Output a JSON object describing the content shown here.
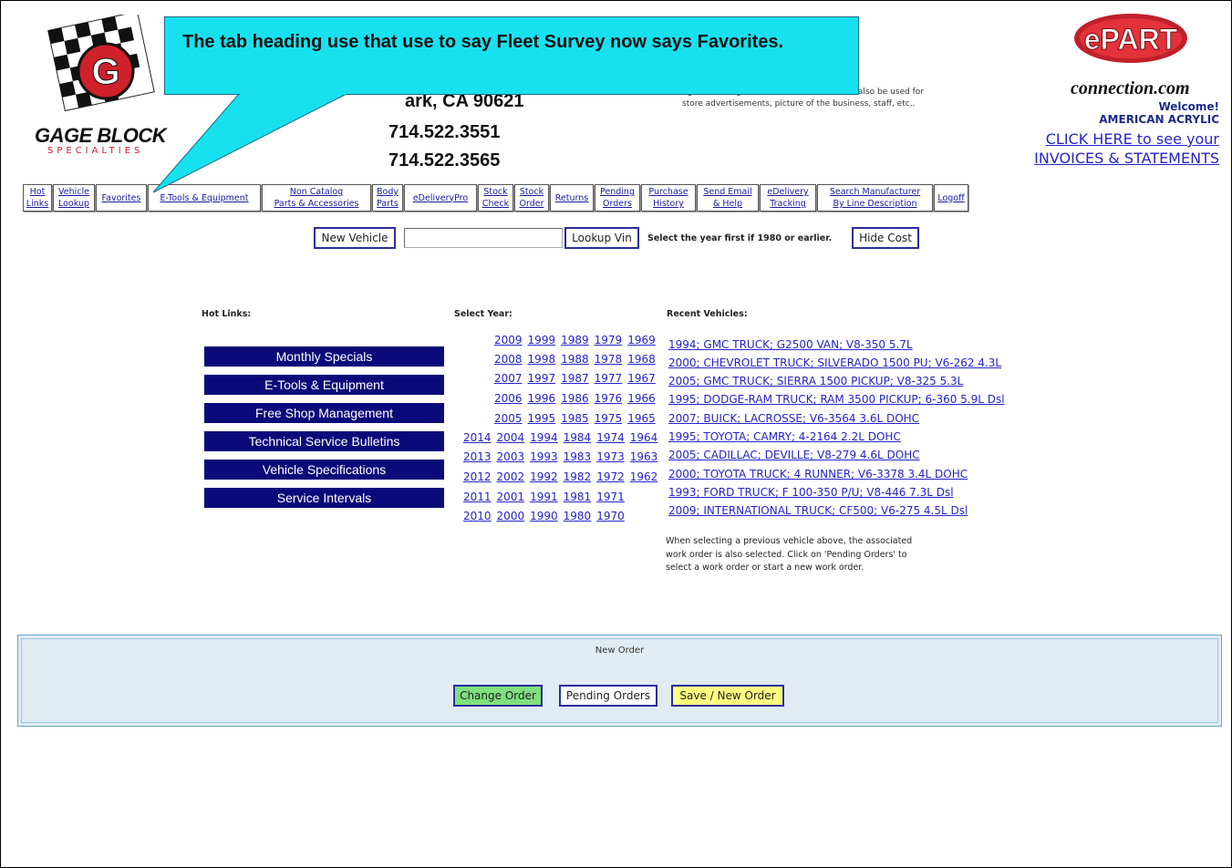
{
  "header": {
    "logo": {
      "line1": "GAGE BLOCK",
      "line2": "SPECIALTIES"
    },
    "address_partial": "ark, CA 90621",
    "phone1": "714.522.3551",
    "phone2": "714.522.3565",
    "store_info": "ng and honing This area of the screen can also be used for store advertisements, picture of the business, staff, etc,.",
    "epart_logo": "ePART connection.com",
    "welcome_label": "Welcome!",
    "welcome_name": "AMERICAN ACRYLIC",
    "invoices_line1": "CLICK HERE to see your",
    "invoices_line2": "INVOICES & STATEMENTS"
  },
  "callout": {
    "text": "The tab heading use that use to say Fleet Survey now says Favorites."
  },
  "nav": {
    "tabs": [
      {
        "line1": "Hot",
        "line2": "Links"
      },
      {
        "line1": "Vehicle",
        "line2": "Lookup"
      },
      {
        "line1": "Favorites",
        "line2": ""
      },
      {
        "line1": "E-Tools & Equipment",
        "line2": ""
      },
      {
        "line1": "Non Catalog",
        "line2": "Parts & Accessories"
      },
      {
        "line1": "Body",
        "line2": "Parts"
      },
      {
        "line1": "eDeliveryPro",
        "line2": ""
      },
      {
        "line1": "Stock",
        "line2": "Check"
      },
      {
        "line1": "Stock",
        "line2": "Order"
      },
      {
        "line1": "Returns",
        "line2": ""
      },
      {
        "line1": "Pending",
        "line2": "Orders"
      },
      {
        "line1": "Purchase",
        "line2": "History"
      },
      {
        "line1": "Send Email",
        "line2": "& Help"
      },
      {
        "line1": "eDelivery",
        "line2": "Tracking"
      },
      {
        "line1": "Search Manufacturer",
        "line2": "By Line Description"
      },
      {
        "line1": "Logoff",
        "line2": ""
      }
    ]
  },
  "lookup": {
    "new_vehicle": "New Vehicle",
    "vin_value": "",
    "lookup_vin": "Lookup Vin",
    "year_note": "Select the year first if 1980 or earlier.",
    "hide_cost": "Hide Cost"
  },
  "hot_links": {
    "heading": "Hot Links:",
    "items": [
      "Monthly Specials",
      "E-Tools & Equipment",
      "Free Shop Management",
      "Technical Service Bulletins",
      "Vehicle Specifications",
      "Service Intervals"
    ]
  },
  "years": {
    "heading": "Select Year:",
    "rows": [
      [
        "2009",
        "1999",
        "1989",
        "1979",
        "1969"
      ],
      [
        "2008",
        "1998",
        "1988",
        "1978",
        "1968"
      ],
      [
        "2007",
        "1997",
        "1987",
        "1977",
        "1967"
      ],
      [
        "2006",
        "1996",
        "1986",
        "1976",
        "1966"
      ],
      [
        "2005",
        "1995",
        "1985",
        "1975",
        "1965"
      ],
      [
        "2014",
        "2004",
        "1994",
        "1984",
        "1974",
        "1964"
      ],
      [
        "2013",
        "2003",
        "1993",
        "1983",
        "1973",
        "1963"
      ],
      [
        "2012",
        "2002",
        "1992",
        "1982",
        "1972",
        "1962"
      ],
      [
        "2011",
        "2001",
        "1991",
        "1981",
        "1971"
      ],
      [
        "2010",
        "2000",
        "1990",
        "1980",
        "1970"
      ]
    ]
  },
  "recent": {
    "heading": "Recent Vehicles:",
    "items": [
      "1994; GMC TRUCK; G2500 VAN; V8-350 5.7L",
      "2000; CHEVROLET TRUCK; SILVERADO 1500 PU; V6-262 4.3L",
      "2005; GMC TRUCK; SIERRA 1500 PICKUP; V8-325 5.3L",
      "1995; DODGE-RAM TRUCK; RAM 3500 PICKUP; 6-360 5.9L Dsl",
      "2007; BUICK; LACROSSE; V6-3564 3.6L DOHC",
      "1995; TOYOTA; CAMRY; 4-2164 2.2L DOHC",
      "2005; CADILLAC; DEVILLE; V8-279 4.6L DOHC",
      "2000; TOYOTA TRUCK; 4 RUNNER; V6-3378 3.4L DOHC",
      "1993; FORD TRUCK; F 100-350 P/U; V8-446 7.3L Dsl",
      "2009; INTERNATIONAL TRUCK; CF500; V6-275 4.5L Dsl"
    ],
    "note": "When selecting a previous vehicle above, the associated work order is also selected. Click on 'Pending Orders' to select a work order or start a new work order."
  },
  "order": {
    "title": "New Order",
    "change_order": "Change Order",
    "pending_orders": "Pending Orders",
    "save_new_order": "Save / New Order"
  },
  "colors": {
    "hot_button_bg": "#0a0a7a",
    "link": "#2424c8",
    "callout": "#18e1ef",
    "change_order_bg": "#7ee07e",
    "save_order_bg": "#ffff80",
    "order_panel_bg": "#e0ebf4"
  }
}
